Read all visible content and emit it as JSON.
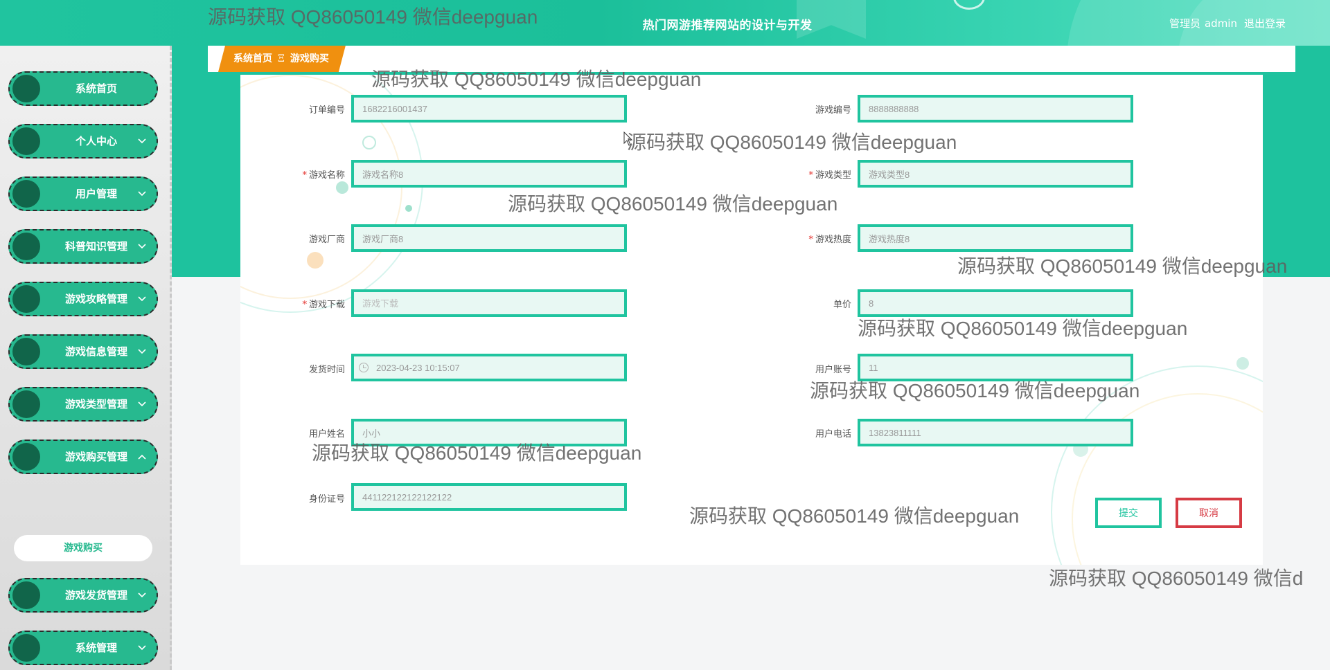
{
  "header": {
    "site_title": "热门网游推荐网站的设计与开发",
    "user_role": "管理员",
    "username": "admin",
    "logout_label": "退出登录"
  },
  "sidebar": {
    "items": [
      {
        "label": "系统首页"
      },
      {
        "label": "个人中心"
      },
      {
        "label": "用户管理"
      },
      {
        "label": "科普知识管理"
      },
      {
        "label": "游戏攻略管理"
      },
      {
        "label": "游戏信息管理"
      },
      {
        "label": "游戏类型管理"
      },
      {
        "label": "游戏购买管理"
      },
      {
        "label": "游戏发货管理"
      },
      {
        "label": "系统管理"
      }
    ],
    "sub_item": "游戏购买"
  },
  "breadcrumb": {
    "home": "系统首页",
    "separator": "Ξ",
    "current": "游戏购买"
  },
  "form": {
    "order_no": {
      "label": "订单编号",
      "value": "1682216001437"
    },
    "game_no": {
      "label": "游戏编号",
      "value": "8888888888"
    },
    "game_name": {
      "label": "游戏名称",
      "value": "游戏名称8"
    },
    "game_type": {
      "label": "游戏类型",
      "value": "游戏类型8"
    },
    "vendor": {
      "label": "游戏厂商",
      "value": "游戏厂商8"
    },
    "heat": {
      "label": "游戏热度",
      "value": "游戏热度8"
    },
    "download": {
      "label": "游戏下载",
      "placeholder": "游戏下载"
    },
    "price": {
      "label": "单价",
      "value": "8"
    },
    "ship_time": {
      "label": "发货时间",
      "value": "2023-04-23 10:15:07"
    },
    "user_account": {
      "label": "用户账号",
      "value": "11"
    },
    "user_name": {
      "label": "用户姓名",
      "value": "小小"
    },
    "user_phone": {
      "label": "用户电话",
      "value": "13823811111"
    },
    "id_card": {
      "label": "身份证号",
      "value": "441122122122122122"
    },
    "submit_label": "提交",
    "cancel_label": "取消"
  },
  "watermark": {
    "text": "源码获取 QQ86050149 微信deepguan",
    "text_clipped": "源码获取 QQ86050149 微信d"
  },
  "colors": {
    "accent": "#20c49f",
    "sidebar_pill": "#27b98f",
    "breadcrumb": "#f0900f",
    "cancel": "#d63b44"
  }
}
